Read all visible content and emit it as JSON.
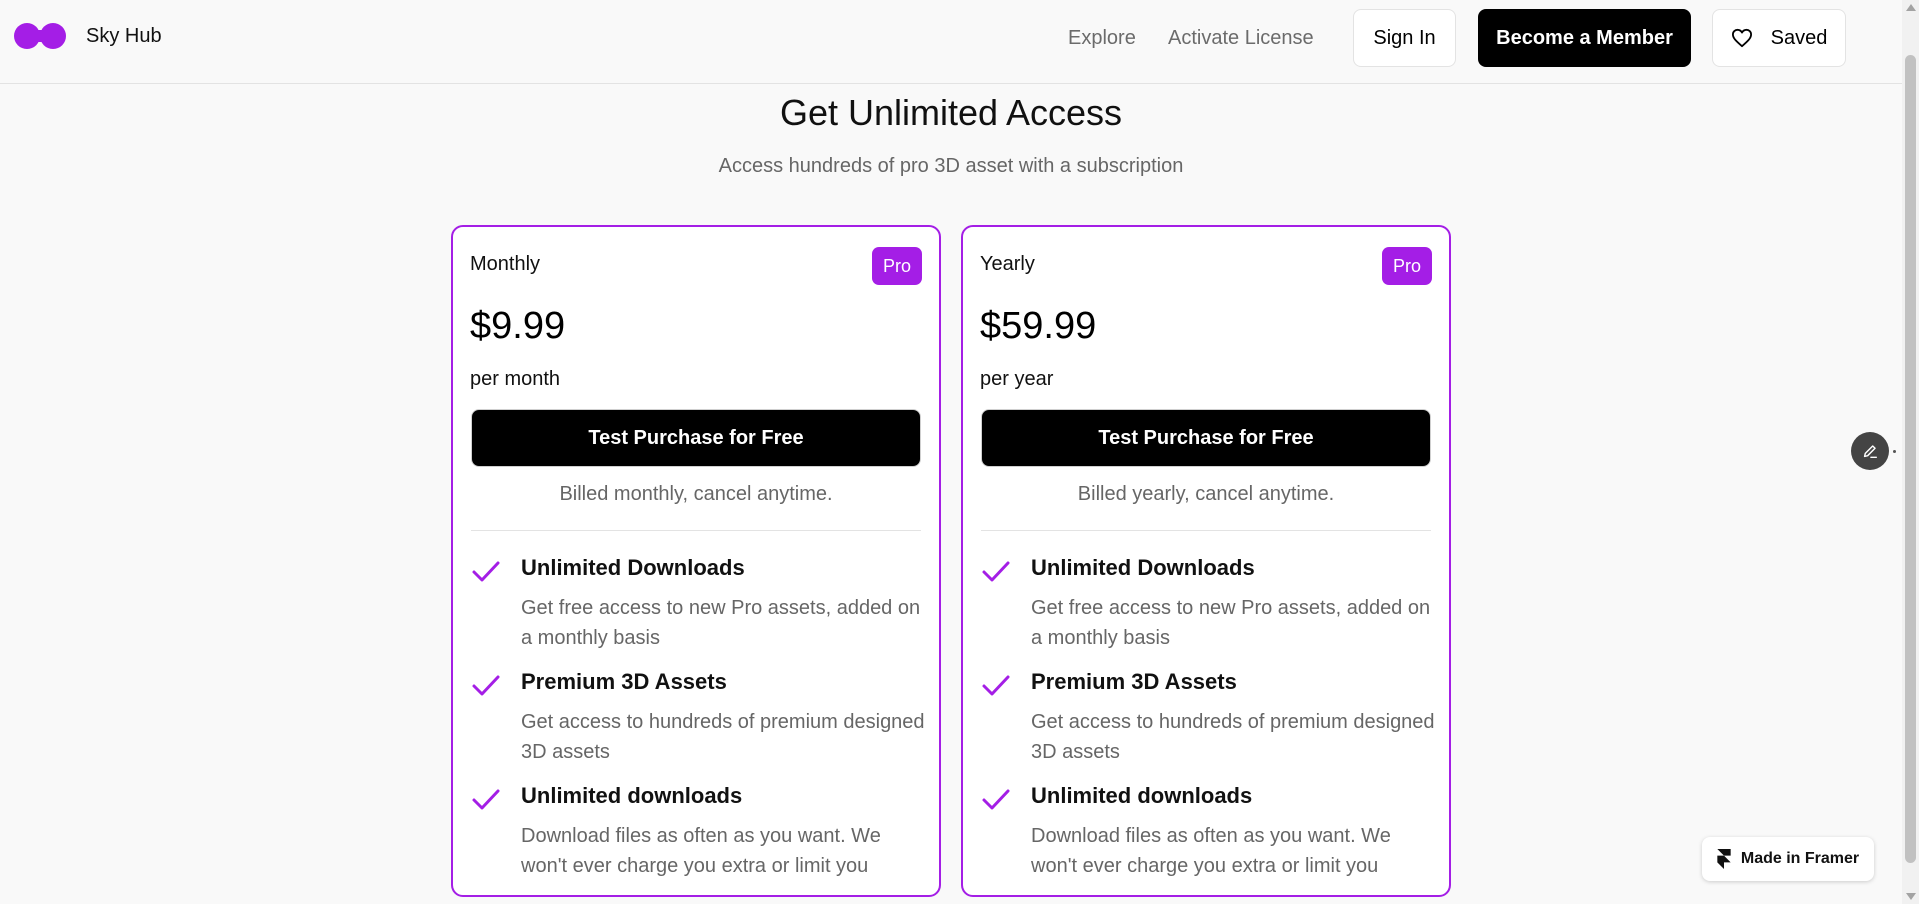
{
  "brand": {
    "name": "Sky Hub",
    "logo_color": "#a41ee6"
  },
  "nav": {
    "explore": "Explore",
    "activate": "Activate License",
    "signin": "Sign In",
    "member": "Become a Member",
    "saved": "Saved"
  },
  "hero": {
    "title": "Get Unlimited Access",
    "subtitle": "Access hundreds of pro 3D asset with a subscription"
  },
  "plans": [
    {
      "name": "Monthly",
      "badge": "Pro",
      "price": "$9.99",
      "period": "per month",
      "cta": "Test Purchase for Free",
      "billing": "Billed monthly, cancel anytime.",
      "features": [
        {
          "title": "Unlimited Downloads",
          "desc": "Get free access to new Pro assets, added on a monthly basis"
        },
        {
          "title": "Premium 3D Assets",
          "desc": "Get access to hundreds of premium designed 3D assets"
        },
        {
          "title": "Unlimited downloads",
          "desc": "Download files as often as you want. We won't ever charge you extra or limit you"
        }
      ]
    },
    {
      "name": "Yearly",
      "badge": "Pro",
      "price": "$59.99",
      "period": "per year",
      "cta": "Test Purchase for Free",
      "billing": "Billed yearly, cancel anytime.",
      "features": [
        {
          "title": "Unlimited Downloads",
          "desc": "Get free access to new Pro assets, added on a monthly basis"
        },
        {
          "title": "Premium 3D Assets",
          "desc": "Get access to hundreds of premium designed 3D assets"
        },
        {
          "title": "Unlimited downloads",
          "desc": "Download files as often as you want. We won't ever charge you extra or limit you"
        }
      ]
    }
  ],
  "framer_badge": "Made in Framer",
  "colors": {
    "accent": "#a41ee6",
    "primary_button": "#000000",
    "muted_text": "#666666"
  },
  "icons": [
    "logo-icon",
    "heart-icon",
    "check-icon",
    "pencil-icon",
    "framer-icon"
  ]
}
